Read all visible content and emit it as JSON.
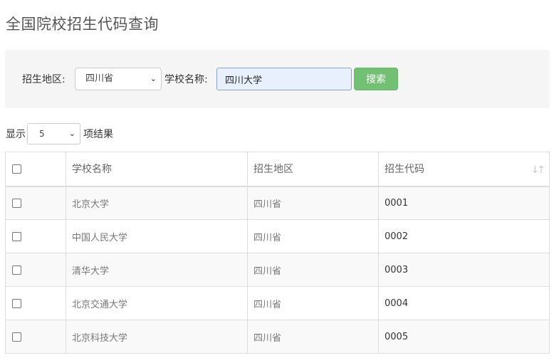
{
  "page": {
    "title": "全国院校招生代码查询"
  },
  "search": {
    "region_label": "招生地区:",
    "region_selected": "四川省",
    "school_label": "学校名称:",
    "school_value": "四川大学",
    "button_label": "搜索",
    "button_color": "#5cb85c"
  },
  "length": {
    "prefix": "显示",
    "selected": "5",
    "suffix": "项结果"
  },
  "table": {
    "headers": {
      "name": "学校名称",
      "region": "招生地区",
      "code": "招生代码"
    },
    "sort_icon": "sort-arrows-icon",
    "rows": [
      {
        "name": "北京大学",
        "region": "四川省",
        "code": "0001",
        "checked": false
      },
      {
        "name": "中国人民大学",
        "region": "四川省",
        "code": "0002",
        "checked": false
      },
      {
        "name": "清华大学",
        "region": "四川省",
        "code": "0003",
        "checked": false
      },
      {
        "name": "北京交通大学",
        "region": "四川省",
        "code": "0004",
        "checked": false
      },
      {
        "name": "北京科技大学",
        "region": "四川省",
        "code": "0005",
        "checked": false
      }
    ]
  }
}
